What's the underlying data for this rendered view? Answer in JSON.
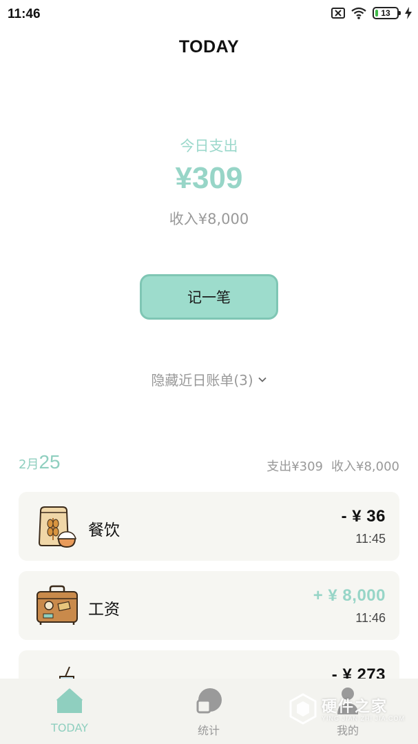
{
  "status_bar": {
    "time": "11:46",
    "battery_level": "13",
    "icons": [
      "sim-x-icon",
      "wifi-icon",
      "battery-icon",
      "charging-icon"
    ]
  },
  "header": {
    "title": "TODAY"
  },
  "summary": {
    "label": "今日支出",
    "amount": "¥309",
    "income": "收入¥8,000"
  },
  "record_button": {
    "label": "记一笔"
  },
  "hidden_toggle": {
    "label": "隐藏近日账单(3)",
    "icon": "chevron-down-icon"
  },
  "date_group": {
    "month": "2月",
    "day": "25",
    "expense": "支出¥309",
    "income": "收入¥8,000"
  },
  "transactions": [
    {
      "title": "餐饮",
      "amount": "- ¥ 36",
      "time": "11:45",
      "type": "expense",
      "icon": "food-icon"
    },
    {
      "title": "工资",
      "amount": "+ ¥ 8,000",
      "time": "11:46",
      "type": "income",
      "icon": "suitcase-icon"
    },
    {
      "title": "一一",
      "amount": "- ¥ 273",
      "time": "",
      "type": "expense",
      "icon": "shopping-icon"
    }
  ],
  "bottom_nav": [
    {
      "label": "TODAY",
      "icon": "home-icon",
      "active": true
    },
    {
      "label": "统计",
      "icon": "chart-icon",
      "active": false
    },
    {
      "label": "我的",
      "icon": "profile-icon",
      "active": false
    }
  ],
  "watermark": {
    "text": "硬件之家",
    "sub": "YING JIAN ZHI JIA.COM"
  },
  "colors": {
    "accent": "#97d5c7",
    "button": "#9ddccc",
    "card_bg": "#f6f6f2",
    "nav_bg": "#f3f3ef"
  }
}
